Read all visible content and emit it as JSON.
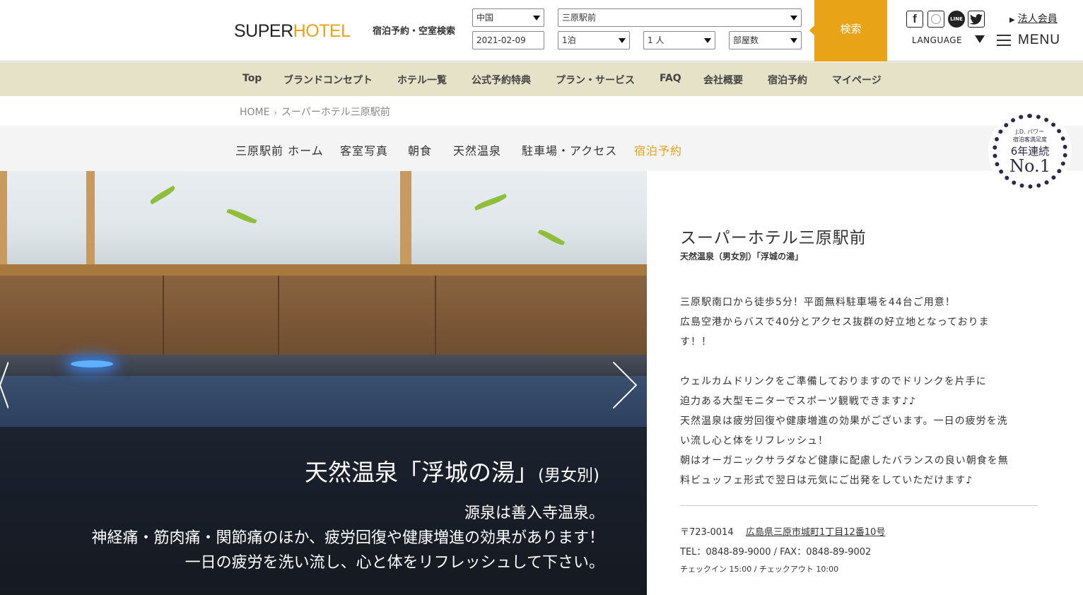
{
  "header": {
    "logo_super": "SUPER",
    "logo_hotel": "HOTEL",
    "search_label": "宿泊予約・空室検索",
    "region": "中国",
    "hotel": "三原駅前",
    "date": "2021-02-09",
    "nights": "1泊",
    "guests": "1 人",
    "rooms": "部屋数",
    "search_button": "検索",
    "corporate_link": "法人会員",
    "language": "LANGUAGE",
    "menu": "MENU",
    "social": {
      "facebook": "f",
      "line": "LINE"
    }
  },
  "global_nav": [
    "Top",
    "ブランドコンセプト",
    "ホテル一覧",
    "公式予約特典",
    "プラン・サービス",
    "FAQ",
    "会社概要",
    "宿泊予約",
    "マイページ"
  ],
  "breadcrumb": {
    "home": "HOME",
    "sep": "›",
    "current": "スーパーホテル三原駅前"
  },
  "local_nav": [
    {
      "label": "三原駅前 ホーム",
      "active": false
    },
    {
      "label": "客室写真",
      "active": false
    },
    {
      "label": "朝食",
      "active": false
    },
    {
      "label": "天然温泉",
      "active": false
    },
    {
      "label": "駐車場・アクセス",
      "active": false
    },
    {
      "label": "宿泊予約",
      "active": true
    }
  ],
  "badge": {
    "line1": "J.D. パワー",
    "line2": "宿泊客満足度",
    "line3": "6年連続",
    "line4": "No.1"
  },
  "hero": {
    "title": "天然温泉「浮城の湯」",
    "title_small": "(男女別)",
    "lines": [
      "源泉は善入寺温泉。",
      "神経痛・筋肉痛・関節痛のほか、疲労回復や健康増進の効果があります！",
      "一日の疲労を洗い流し、心と体をリフレッシュして下さい。"
    ]
  },
  "info": {
    "name": "スーパーホテル三原駅前",
    "subtitle": "天然温泉（男女別）「浮城の湯」",
    "description": [
      "三原駅南口から徒歩5分！平面無料駐車場を44台ご用意！",
      "広島空港からバスで40分とアクセス抜群の好立地となっておりま",
      "す！！",
      "",
      "ウェルカムドリンクをご準備しておりますのでドリンクを片手に",
      "迫力ある大型モニターでスポーツ観戦できます♪♪",
      "天然温泉は疲労回復や健康増進の効果がございます。一日の疲労を洗",
      "い流し心と体をリフレッシュ！",
      "朝はオーガニックサラダなど健康に配慮したバランスの良い朝食を無",
      "料ビュッフェ形式で翌日は元気にご出発をしていただけます♪"
    ],
    "postal": "〒723-0014",
    "address": "広島県三原市城町1丁目12番10号",
    "tel": "TEL：0848-89-9000 / FAX：0848-89-9002",
    "checkin": "チェックイン 15:00 / チェックアウト 10:00"
  },
  "colors": {
    "accent": "#e8a317",
    "nav_bg": "#e6e2c7",
    "local_nav_bg": "#f4f4f4"
  }
}
